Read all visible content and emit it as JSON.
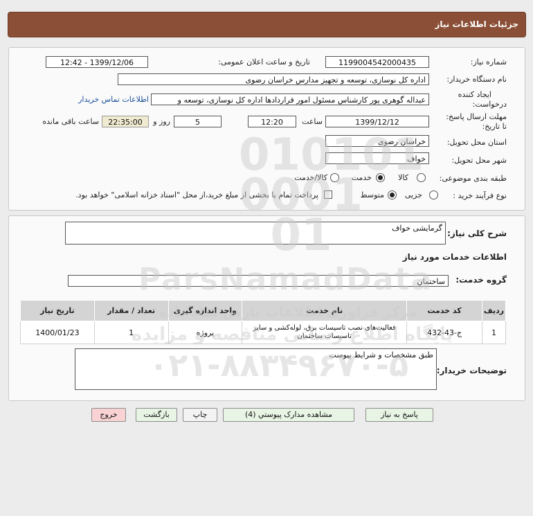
{
  "header": {
    "title": "جزئیات اطلاعات نیاز"
  },
  "info": {
    "need_number_label": "شماره نیاز:",
    "need_number": "1199004542000435",
    "announce_label": "تاریخ و ساعت اعلان عمومی:",
    "announce_value": "1399/12/06 - 12:42",
    "buyer_label": "نام دستگاه خریدار:",
    "buyer_value": "اداره کل نوسازی، توسعه و تجهیز مدارس خراسان رضوی",
    "creator_label_1": "ایجاد کننده",
    "creator_label_2": "درخواست:",
    "creator_value": "عبداله گوهری پور کارشناس مسئول امور قراردادها  اداره کل نوسازی، توسعه و",
    "contact_link": "اطلاعات تماس خریدار",
    "deadline_label_1": "مهلت ارسال پاسخ:",
    "deadline_label_2": "تا تاریخ:",
    "deadline_date": "1399/12/12",
    "time_label": "ساعت",
    "deadline_time": "12:20",
    "day_count": "5",
    "day_label": "روز و",
    "remaining_time": "22:35:00",
    "remaining_label": "ساعت باقی مانده",
    "province_label": "استان محل تحویل:",
    "province_value": "خراسان رضوی",
    "city_label": "شهر محل تحویل:",
    "city_value": "خواف",
    "category_label": "طبقه بندی موضوعی:",
    "category_options": [
      "کالا",
      "خدمت",
      "کالا/خدمت"
    ],
    "category_selected": "خدمت",
    "process_label": "نوع فرآیند خرید :",
    "process_options": [
      "جزیی",
      "متوسط"
    ],
    "process_selected": "متوسط",
    "payment_note": "پرداخت تمام یا بخشی از مبلغ خرید،از محل \"اسناد خزانه اسلامی\" خواهد بود."
  },
  "details": {
    "summary_label": "شرح کلی نیاز:",
    "summary_value": "گرمایشی خواف",
    "services_title": "اطلاعات خدمات مورد نیاز",
    "group_label": "گروه خدمت:",
    "group_value": "ساختمان",
    "table": {
      "headers": [
        "ردیف",
        "کد خدمت",
        "نام خدمت",
        "واحد اندازه گیری",
        "تعداد / مقدار",
        "تاریخ نیاز"
      ],
      "rows": [
        {
          "row": "1",
          "code": "ج-43-432",
          "name": "فعالیت‌های نصب تاسیسات برق، لوله‌کشی و سایر تاسیسات ساختمان",
          "unit": "پروژه",
          "qty": "1",
          "date": "1400/01/23"
        }
      ]
    },
    "buyer_notes_label": "توضیحات خریدار:",
    "buyer_notes_value": "طبق مشخصات و شرایط پیوست"
  },
  "buttons": {
    "reply": "پاسخ به نیاز",
    "attachments": "مشاهده مدارک پیوستي (4)",
    "print": "چاپ",
    "back": "بازگشت",
    "exit": "خروج"
  },
  "watermark": {
    "site": "ParsNamadData",
    "phone": "۰۲۱-۸۸۳۴۹۶۷۰-۵",
    "fa_line1": "مرکز فراوری اطلاعات پارس نماد داده",
    "fa_line2": "پایگاه اطلاع رسانی مناقصه و مزایده"
  },
  "colors": {
    "header_bg": "#8a4f36",
    "remaining_bg": "#f0ead0",
    "exit_bg": "#f9d3d3",
    "green_btn_bg": "#e8f5e4",
    "link": "#1a4f9c"
  }
}
